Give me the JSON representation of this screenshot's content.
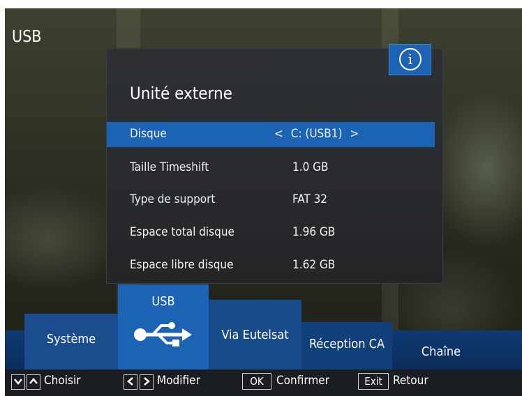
{
  "header": {
    "title": "USB"
  },
  "panel": {
    "title": "Unité externe",
    "info_icon_glyph": "i",
    "rows": [
      {
        "label": "Disque",
        "value": "C: (USB1)",
        "left_arrow": "<",
        "right_arrow": ">"
      },
      {
        "label": "Taille Timeshift",
        "value": "1.0 GB"
      },
      {
        "label": "Type de support",
        "value": "FAT 32"
      },
      {
        "label": "Espace total disque",
        "value": "1.96 GB"
      },
      {
        "label": "Espace libre disque",
        "value": "1.62 GB"
      }
    ]
  },
  "tabs": [
    {
      "label": "Système"
    },
    {
      "label": "USB",
      "icon": "usb-icon"
    },
    {
      "label": "Via Eutelsat"
    },
    {
      "label": "Réception CA"
    },
    {
      "label": "Chaîne"
    }
  ],
  "footer": {
    "choose_label": "Choisir",
    "modify_label": "Modifier",
    "ok_key": "OK",
    "confirm_label": "Confirmer",
    "exit_key": "Exit",
    "back_label": "Retour"
  },
  "colors": {
    "accent": "#1c63b5",
    "tabbar": "#0e3a73",
    "panel": "#2b2e31"
  }
}
